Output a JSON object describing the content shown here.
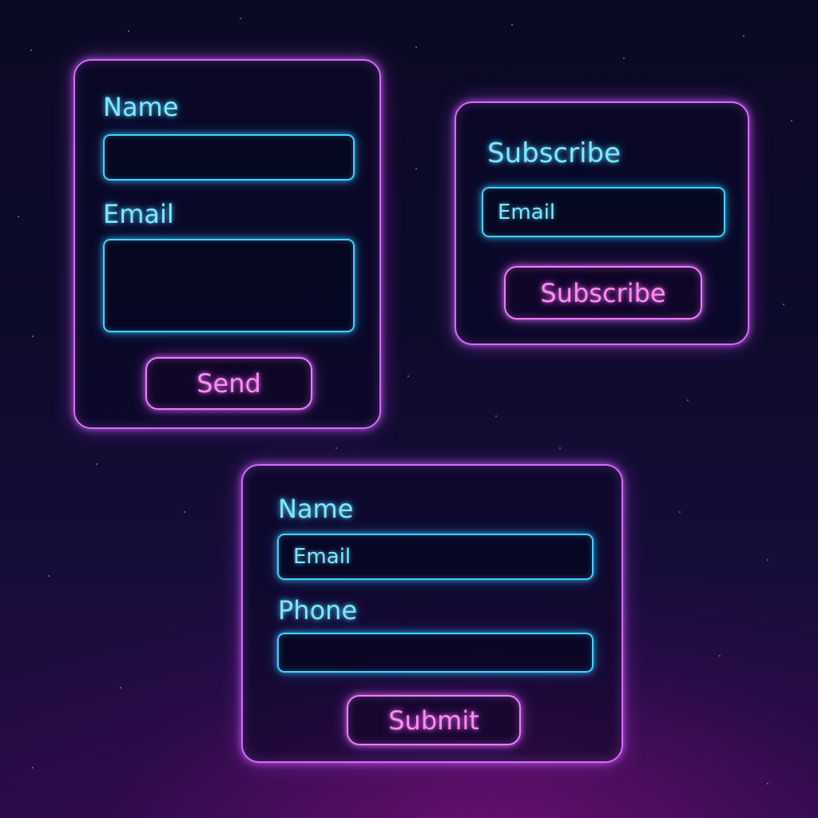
{
  "contact_form": {
    "name_label": "Name",
    "email_label": "Email",
    "send_button": "Send"
  },
  "subscribe_form": {
    "title": "Subscribe",
    "email_placeholder": "Email",
    "subscribe_button": "Subscribe"
  },
  "signup_form": {
    "name_label": "Name",
    "email_placeholder": "Email",
    "phone_label": "Phone",
    "submit_button": "Submit"
  },
  "colors": {
    "card_border": "#d66bff",
    "field_border": "#3fd3ff",
    "label_text": "#7ee8ff",
    "button_text": "#ff8cf4"
  }
}
